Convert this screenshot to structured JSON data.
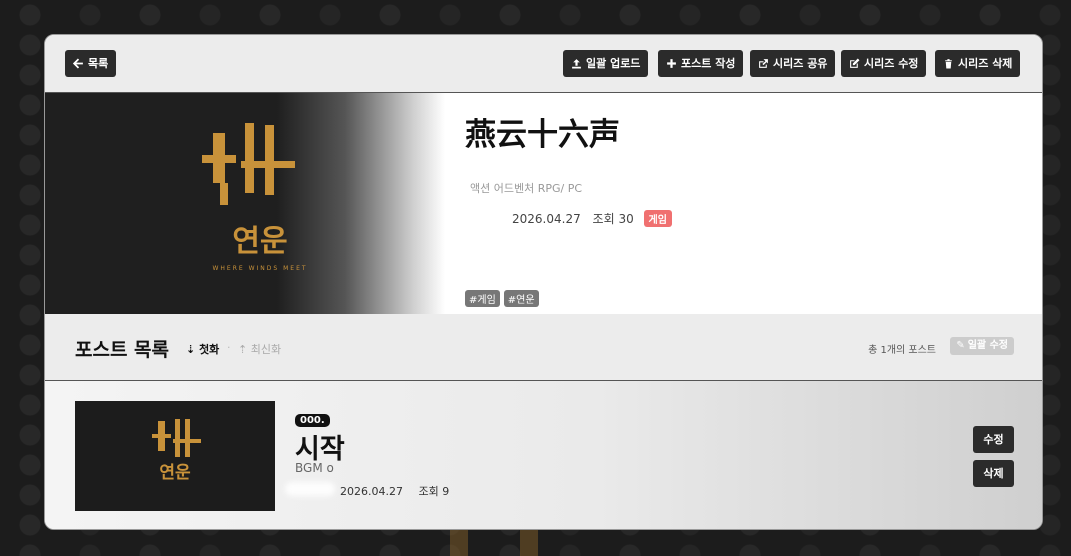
{
  "toolbar": {
    "back_label": "목록",
    "bulk_upload_label": "일괄 업로드",
    "write_post_label": "포스트 작성",
    "share_series_label": "시리즈 공유",
    "edit_series_label": "시리즈 수정",
    "delete_series_label": "시리즈 삭제"
  },
  "series": {
    "title": "燕云十六声",
    "date": "2026.04.27",
    "views": "조회 30",
    "category_badge": "게임",
    "description": "액션 어드벤처 RPG/ PC",
    "tags": [
      "#게임",
      "#연운"
    ],
    "art_text": "연운",
    "art_subtext": "WHERE WINDS MEET"
  },
  "post_list": {
    "heading": "포스트 목록",
    "sort_first": "첫화",
    "sort_latest": "최신화",
    "count_text": "총 1개의 포스트",
    "bulk_edit_label": "일괄 수정"
  },
  "posts": [
    {
      "number": "000.",
      "title": "시작",
      "subtitle": "BGM o",
      "date": "2026.04.27",
      "views": "조회 9",
      "edit_label": "수정",
      "delete_label": "삭제",
      "thumb_text": "연운"
    }
  ],
  "colors": {
    "accent_badge": "#f07070",
    "button_dark": "#2b2b2b",
    "gold": "#c8923a"
  }
}
